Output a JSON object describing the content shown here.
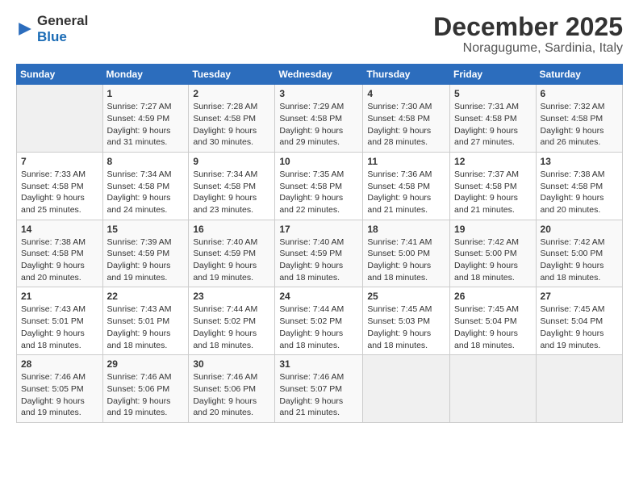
{
  "header": {
    "logo_general": "General",
    "logo_blue": "Blue",
    "month_title": "December 2025",
    "subtitle": "Noragugume, Sardinia, Italy"
  },
  "weekdays": [
    "Sunday",
    "Monday",
    "Tuesday",
    "Wednesday",
    "Thursday",
    "Friday",
    "Saturday"
  ],
  "weeks": [
    [
      {
        "day": "",
        "sunrise": "",
        "sunset": "",
        "daylight": ""
      },
      {
        "day": "1",
        "sunrise": "Sunrise: 7:27 AM",
        "sunset": "Sunset: 4:59 PM",
        "daylight": "Daylight: 9 hours and 31 minutes."
      },
      {
        "day": "2",
        "sunrise": "Sunrise: 7:28 AM",
        "sunset": "Sunset: 4:58 PM",
        "daylight": "Daylight: 9 hours and 30 minutes."
      },
      {
        "day": "3",
        "sunrise": "Sunrise: 7:29 AM",
        "sunset": "Sunset: 4:58 PM",
        "daylight": "Daylight: 9 hours and 29 minutes."
      },
      {
        "day": "4",
        "sunrise": "Sunrise: 7:30 AM",
        "sunset": "Sunset: 4:58 PM",
        "daylight": "Daylight: 9 hours and 28 minutes."
      },
      {
        "day": "5",
        "sunrise": "Sunrise: 7:31 AM",
        "sunset": "Sunset: 4:58 PM",
        "daylight": "Daylight: 9 hours and 27 minutes."
      },
      {
        "day": "6",
        "sunrise": "Sunrise: 7:32 AM",
        "sunset": "Sunset: 4:58 PM",
        "daylight": "Daylight: 9 hours and 26 minutes."
      }
    ],
    [
      {
        "day": "7",
        "sunrise": "Sunrise: 7:33 AM",
        "sunset": "Sunset: 4:58 PM",
        "daylight": "Daylight: 9 hours and 25 minutes."
      },
      {
        "day": "8",
        "sunrise": "Sunrise: 7:34 AM",
        "sunset": "Sunset: 4:58 PM",
        "daylight": "Daylight: 9 hours and 24 minutes."
      },
      {
        "day": "9",
        "sunrise": "Sunrise: 7:34 AM",
        "sunset": "Sunset: 4:58 PM",
        "daylight": "Daylight: 9 hours and 23 minutes."
      },
      {
        "day": "10",
        "sunrise": "Sunrise: 7:35 AM",
        "sunset": "Sunset: 4:58 PM",
        "daylight": "Daylight: 9 hours and 22 minutes."
      },
      {
        "day": "11",
        "sunrise": "Sunrise: 7:36 AM",
        "sunset": "Sunset: 4:58 PM",
        "daylight": "Daylight: 9 hours and 21 minutes."
      },
      {
        "day": "12",
        "sunrise": "Sunrise: 7:37 AM",
        "sunset": "Sunset: 4:58 PM",
        "daylight": "Daylight: 9 hours and 21 minutes."
      },
      {
        "day": "13",
        "sunrise": "Sunrise: 7:38 AM",
        "sunset": "Sunset: 4:58 PM",
        "daylight": "Daylight: 9 hours and 20 minutes."
      }
    ],
    [
      {
        "day": "14",
        "sunrise": "Sunrise: 7:38 AM",
        "sunset": "Sunset: 4:58 PM",
        "daylight": "Daylight: 9 hours and 20 minutes."
      },
      {
        "day": "15",
        "sunrise": "Sunrise: 7:39 AM",
        "sunset": "Sunset: 4:59 PM",
        "daylight": "Daylight: 9 hours and 19 minutes."
      },
      {
        "day": "16",
        "sunrise": "Sunrise: 7:40 AM",
        "sunset": "Sunset: 4:59 PM",
        "daylight": "Daylight: 9 hours and 19 minutes."
      },
      {
        "day": "17",
        "sunrise": "Sunrise: 7:40 AM",
        "sunset": "Sunset: 4:59 PM",
        "daylight": "Daylight: 9 hours and 18 minutes."
      },
      {
        "day": "18",
        "sunrise": "Sunrise: 7:41 AM",
        "sunset": "Sunset: 5:00 PM",
        "daylight": "Daylight: 9 hours and 18 minutes."
      },
      {
        "day": "19",
        "sunrise": "Sunrise: 7:42 AM",
        "sunset": "Sunset: 5:00 PM",
        "daylight": "Daylight: 9 hours and 18 minutes."
      },
      {
        "day": "20",
        "sunrise": "Sunrise: 7:42 AM",
        "sunset": "Sunset: 5:00 PM",
        "daylight": "Daylight: 9 hours and 18 minutes."
      }
    ],
    [
      {
        "day": "21",
        "sunrise": "Sunrise: 7:43 AM",
        "sunset": "Sunset: 5:01 PM",
        "daylight": "Daylight: 9 hours and 18 minutes."
      },
      {
        "day": "22",
        "sunrise": "Sunrise: 7:43 AM",
        "sunset": "Sunset: 5:01 PM",
        "daylight": "Daylight: 9 hours and 18 minutes."
      },
      {
        "day": "23",
        "sunrise": "Sunrise: 7:44 AM",
        "sunset": "Sunset: 5:02 PM",
        "daylight": "Daylight: 9 hours and 18 minutes."
      },
      {
        "day": "24",
        "sunrise": "Sunrise: 7:44 AM",
        "sunset": "Sunset: 5:02 PM",
        "daylight": "Daylight: 9 hours and 18 minutes."
      },
      {
        "day": "25",
        "sunrise": "Sunrise: 7:45 AM",
        "sunset": "Sunset: 5:03 PM",
        "daylight": "Daylight: 9 hours and 18 minutes."
      },
      {
        "day": "26",
        "sunrise": "Sunrise: 7:45 AM",
        "sunset": "Sunset: 5:04 PM",
        "daylight": "Daylight: 9 hours and 18 minutes."
      },
      {
        "day": "27",
        "sunrise": "Sunrise: 7:45 AM",
        "sunset": "Sunset: 5:04 PM",
        "daylight": "Daylight: 9 hours and 19 minutes."
      }
    ],
    [
      {
        "day": "28",
        "sunrise": "Sunrise: 7:46 AM",
        "sunset": "Sunset: 5:05 PM",
        "daylight": "Daylight: 9 hours and 19 minutes."
      },
      {
        "day": "29",
        "sunrise": "Sunrise: 7:46 AM",
        "sunset": "Sunset: 5:06 PM",
        "daylight": "Daylight: 9 hours and 19 minutes."
      },
      {
        "day": "30",
        "sunrise": "Sunrise: 7:46 AM",
        "sunset": "Sunset: 5:06 PM",
        "daylight": "Daylight: 9 hours and 20 minutes."
      },
      {
        "day": "31",
        "sunrise": "Sunrise: 7:46 AM",
        "sunset": "Sunset: 5:07 PM",
        "daylight": "Daylight: 9 hours and 21 minutes."
      },
      {
        "day": "",
        "sunrise": "",
        "sunset": "",
        "daylight": ""
      },
      {
        "day": "",
        "sunrise": "",
        "sunset": "",
        "daylight": ""
      },
      {
        "day": "",
        "sunrise": "",
        "sunset": "",
        "daylight": ""
      }
    ]
  ]
}
